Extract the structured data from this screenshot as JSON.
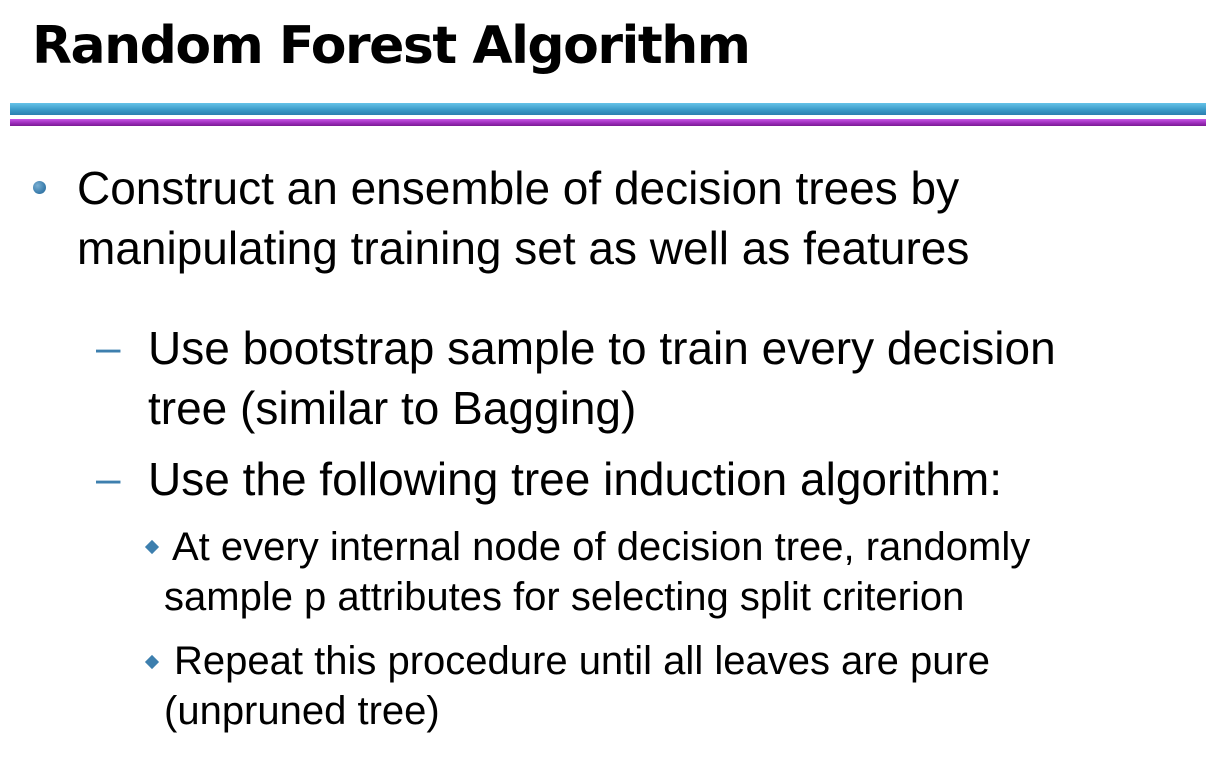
{
  "slide": {
    "title": "Random Forest Algorithm"
  },
  "bullets": {
    "l1": {
      "line1": "Construct an ensemble of decision trees by",
      "line2": "manipulating training set as well as features"
    },
    "sub1": {
      "marker": "–",
      "line1": "Use bootstrap sample to train every decision",
      "line2": "tree (similar to Bagging)"
    },
    "sub2": {
      "marker": "–",
      "line1": "Use the following tree induction algorithm:"
    },
    "subsub1": {
      "line1": "At every internal node of decision tree, randomly",
      "line2": "sample p attributes for selecting split criterion"
    },
    "subsub2": {
      "line1": "Repeat this procedure until all leaves are pure",
      "line2": "(unpruned tree)"
    }
  },
  "colors": {
    "accent_blue": "#3d7fae",
    "rule_cyan": "#3c9bc9",
    "rule_magenta": "#9a2bb8"
  }
}
